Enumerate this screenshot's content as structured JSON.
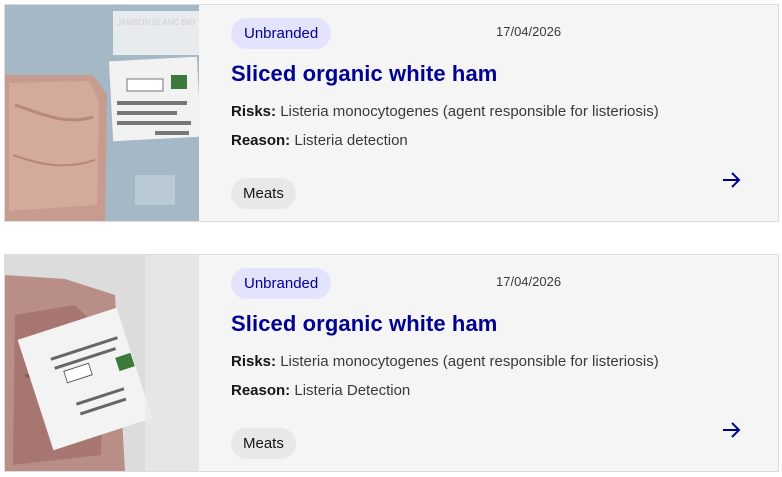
{
  "cards": [
    {
      "brand": "Unbranded",
      "date": "17/04/2026",
      "title": "Sliced organic white ham",
      "risks_label": "Risks:",
      "risks_text": "Listeria monocytogenes (agent responsible for listeriosis)",
      "reason_label": "Reason:",
      "reason_text": "Listeria detection",
      "category": "Meats"
    },
    {
      "brand": "Unbranded",
      "date": "17/04/2026",
      "title": "Sliced organic white ham",
      "risks_label": "Risks:",
      "risks_text": "Listeria monocytogenes (agent responsible for listeriosis)",
      "reason_label": "Reason:",
      "reason_text": "Listeria Detection",
      "category": "Meats"
    }
  ],
  "icons": {
    "open": "arrow-right-icon"
  },
  "colors": {
    "accent": "#000091",
    "badge_bg": "#e3e3fd",
    "card_bg": "#f5f5f5"
  }
}
